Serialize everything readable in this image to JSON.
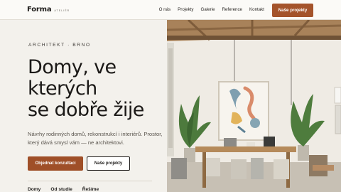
{
  "brand": {
    "name": "Forma",
    "sub": "ATELIÉR"
  },
  "nav": {
    "items": [
      {
        "label": "O nás"
      },
      {
        "label": "Projekty"
      },
      {
        "label": "Galerie"
      },
      {
        "label": "Reference"
      },
      {
        "label": "Kontakt"
      }
    ],
    "cta_label": "Naše projekty"
  },
  "hero": {
    "eyebrow": "ARCHITEKT · BRNO",
    "headline": [
      "Domy, ve",
      "kterých",
      "se dobře žije"
    ],
    "lead": "Návrhy rodinných domů, rekonstrukcí i interiérů. Prostor, který dává smysl vám — ne architektovi.",
    "primary_label": "Objednat konzultaci",
    "secondary_label": "Naše projekty",
    "stats": [
      "Domy",
      "Od studie",
      "Řešíme"
    ]
  },
  "colors": {
    "accent": "#a4532b",
    "background": "#f3f1ec",
    "text": "#1f1d1b"
  }
}
